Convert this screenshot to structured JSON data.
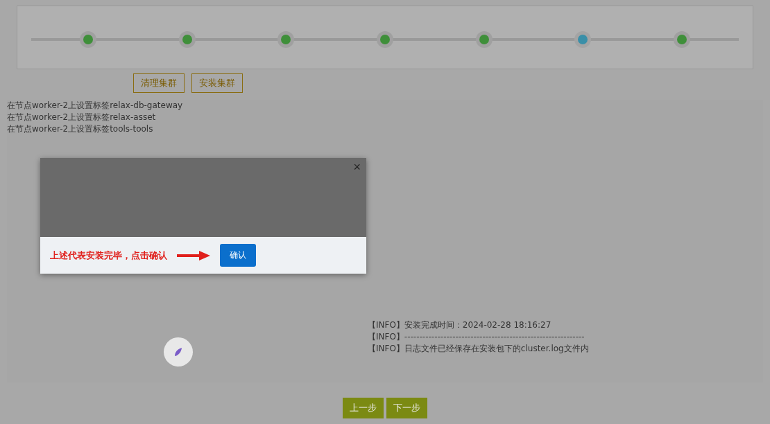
{
  "steps": [
    {
      "completed": true,
      "selected": false
    },
    {
      "completed": true,
      "selected": false
    },
    {
      "completed": true,
      "selected": false
    },
    {
      "completed": true,
      "selected": false
    },
    {
      "completed": true,
      "selected": false
    },
    {
      "completed": false,
      "selected": true
    },
    {
      "completed": true,
      "selected": false
    }
  ],
  "actions": [
    "清理集群",
    "安装集群"
  ],
  "log_top": [
    "在节点worker-2上设置标签relax-db-gateway",
    "在节点worker-2上设置标签relax-asset",
    "在节点worker-2上设置标签tools-tools"
  ],
  "log_bottom": [
    "【INFO】安装完成时间：2024-02-28 18:16:27",
    "【INFO】------------------------------------------------------------",
    "【INFO】日志文件已经保存在安装包下的cluster.log文件内"
  ],
  "dialog": {
    "close": "×",
    "note": "上述代表安装完毕，点击确认",
    "confirm": "确认"
  },
  "nav": [
    "上一步",
    "下一步"
  ]
}
